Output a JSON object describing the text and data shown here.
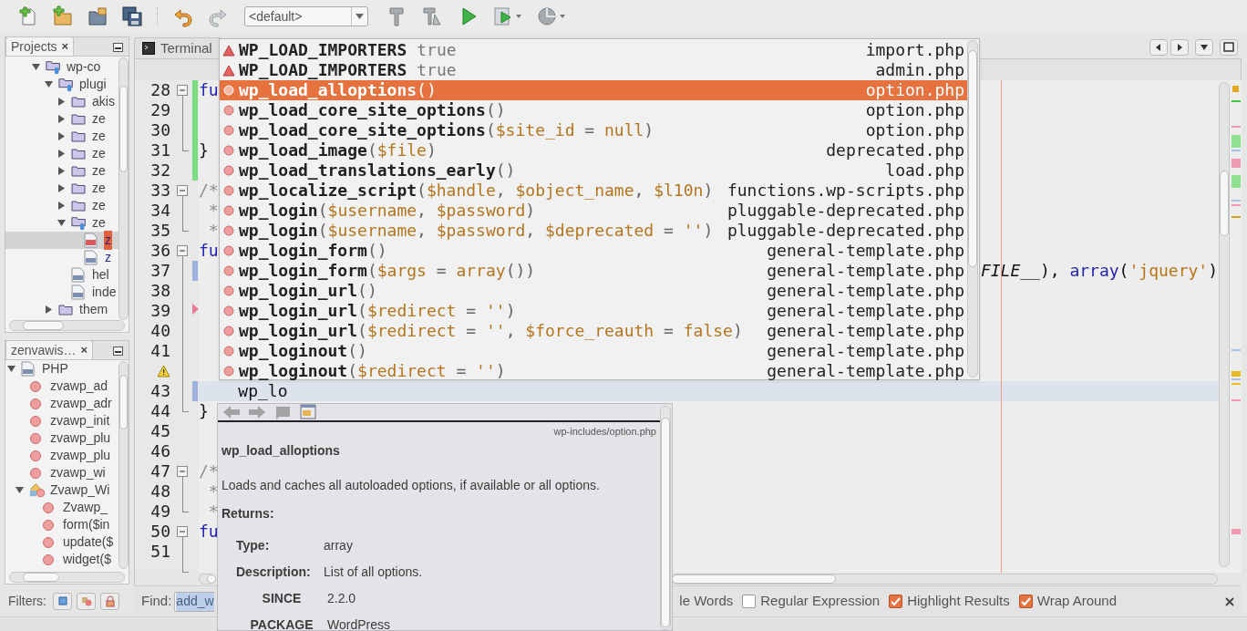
{
  "toolbar": {
    "config": "<default>"
  },
  "projects": {
    "title": "Projects",
    "close": "×",
    "tree": [
      {
        "label": "wp-co",
        "kind": "project",
        "expanded": true,
        "selected": false,
        "children": [
          {
            "label": "plugi",
            "kind": "project",
            "expanded": true,
            "selected": false,
            "children": [
              {
                "label": "akis",
                "kind": "folder",
                "expanded": false,
                "selected": false
              },
              {
                "label": "ze",
                "kind": "folder",
                "expanded": false,
                "selected": false
              },
              {
                "label": "ze",
                "kind": "folder",
                "expanded": false,
                "selected": false
              },
              {
                "label": "ze",
                "kind": "folder",
                "expanded": false,
                "selected": false
              },
              {
                "label": "ze",
                "kind": "folder",
                "expanded": false,
                "selected": false
              },
              {
                "label": "ze",
                "kind": "folder",
                "expanded": false,
                "selected": false
              },
              {
                "label": "ze",
                "kind": "folder",
                "expanded": false,
                "selected": false
              },
              {
                "label": "ze",
                "kind": "project",
                "expanded": true,
                "selected": false,
                "children": [
                  {
                    "label": "z",
                    "kind": "js",
                    "selected": true
                  },
                  {
                    "label": "z",
                    "kind": "php",
                    "selected": false
                  }
                ]
              },
              {
                "label": "hel",
                "kind": "php",
                "selected": false
              },
              {
                "label": "inde",
                "kind": "php",
                "selected": false
              }
            ]
          },
          {
            "label": "them",
            "kind": "folder",
            "expanded": false,
            "selected": false
          }
        ]
      }
    ]
  },
  "navigator": {
    "title": "zenvawis…",
    "close": "×",
    "tree": [
      {
        "label": "PHP",
        "kind": "php",
        "expanded": true,
        "selected": false,
        "children": [
          {
            "label": "zvawp_ad",
            "kind": "function",
            "selected": false
          },
          {
            "label": "zvawp_adr",
            "kind": "function",
            "selected": false
          },
          {
            "label": "zvawp_init",
            "kind": "function",
            "selected": false
          },
          {
            "label": "zvawp_plu",
            "kind": "function",
            "selected": false
          },
          {
            "label": "zvawp_plu",
            "kind": "function",
            "selected": false
          },
          {
            "label": "zvawp_wi",
            "kind": "function",
            "selected": false
          },
          {
            "label": "Zvawp_Wi",
            "kind": "class",
            "expanded": true,
            "selected": false,
            "children": [
              {
                "label": "Zvawp_",
                "kind": "function",
                "selected": false
              },
              {
                "label": "form($in",
                "kind": "function",
                "selected": false
              },
              {
                "label": "update($",
                "kind": "function",
                "selected": false
              },
              {
                "label": "widget($",
                "kind": "function",
                "selected": false
              }
            ]
          }
        ]
      }
    ]
  },
  "filters": {
    "label": "Filters:",
    "buttons": [
      {
        "kind": "fields"
      },
      {
        "kind": "static"
      },
      {
        "kind": "private"
      }
    ]
  },
  "editor": {
    "tabs": [
      {
        "label": "Terminal"
      }
    ],
    "lines": [
      {
        "number": "28",
        "current": false,
        "marks": [
          {
            "kind": "fold_start"
          },
          {
            "kind": "added"
          }
        ],
        "code": [
          {
            "text": "fu",
            "kind": "keyword"
          }
        ]
      },
      {
        "number": "29",
        "current": false,
        "marks": [
          {
            "kind": "fold_line"
          },
          {
            "kind": "added"
          }
        ]
      },
      {
        "number": "30",
        "current": false,
        "marks": [
          {
            "kind": "fold_line"
          },
          {
            "kind": "added"
          }
        ]
      },
      {
        "number": "31",
        "current": false,
        "marks": [
          {
            "kind": "fold_end"
          },
          {
            "kind": "added"
          }
        ],
        "code": [
          {
            "text": "}",
            "kind": "plain"
          }
        ]
      },
      {
        "number": "32",
        "current": false,
        "marks": [
          {
            "kind": "added"
          }
        ]
      },
      {
        "number": "33",
        "current": false,
        "marks": [
          {
            "kind": "fold_start"
          }
        ],
        "code": [
          {
            "text": "/*",
            "kind": "comment"
          }
        ]
      },
      {
        "number": "34",
        "current": false,
        "marks": [
          {
            "kind": "fold_line"
          }
        ],
        "code": [
          {
            "text": " *",
            "kind": "comment"
          }
        ]
      },
      {
        "number": "35",
        "current": false,
        "marks": [
          {
            "kind": "fold_end"
          }
        ],
        "code": [
          {
            "text": " *",
            "kind": "comment"
          }
        ]
      },
      {
        "number": "36",
        "current": false,
        "marks": [
          {
            "kind": "fold_start"
          }
        ],
        "code": [
          {
            "text": "fu",
            "kind": "keyword"
          }
        ]
      },
      {
        "number": "37",
        "current": false,
        "marks": [
          {
            "kind": "fold_line"
          },
          {
            "kind": "modified"
          }
        ],
        "tail": [
          {
            "text": "FILE__",
            "kind": "constant"
          },
          {
            "text": "), ",
            "kind": "plain"
          },
          {
            "text": "array",
            "kind": "keyword"
          },
          {
            "text": "(",
            "kind": "plain"
          },
          {
            "text": "'jquery'",
            "kind": "string"
          },
          {
            "text": ")",
            "kind": "plain"
          }
        ]
      },
      {
        "number": "38",
        "current": false,
        "marks": [
          {
            "kind": "fold_line"
          }
        ]
      },
      {
        "number": "39",
        "current": false,
        "marks": [
          {
            "kind": "fold_line"
          },
          {
            "kind": "deleted"
          }
        ]
      },
      {
        "number": "40",
        "current": false,
        "marks": [
          {
            "kind": "fold_line"
          }
        ]
      },
      {
        "number": "41",
        "current": false,
        "marks": [
          {
            "kind": "fold_line"
          }
        ]
      },
      {
        "current": false,
        "marks": [
          {
            "kind": "warning"
          },
          {
            "kind": "fold_line"
          }
        ]
      },
      {
        "number": "43",
        "current": true,
        "marks": [
          {
            "kind": "fold_line"
          },
          {
            "kind": "modified"
          }
        ],
        "code": [
          {
            "text": "    wp_lo",
            "kind": "plain"
          }
        ]
      },
      {
        "number": "44",
        "current": false,
        "marks": [
          {
            "kind": "fold_end"
          }
        ],
        "code": [
          {
            "text": "}",
            "kind": "plain"
          }
        ]
      },
      {
        "number": "45",
        "current": false
      },
      {
        "number": "46",
        "current": false
      },
      {
        "number": "47",
        "current": false,
        "marks": [
          {
            "kind": "fold_start"
          }
        ],
        "code": [
          {
            "text": "/*",
            "kind": "comment"
          }
        ]
      },
      {
        "number": "48",
        "current": false,
        "marks": [
          {
            "kind": "fold_line"
          }
        ],
        "code": [
          {
            "text": " *",
            "kind": "comment"
          }
        ]
      },
      {
        "number": "49",
        "current": false,
        "marks": [
          {
            "kind": "fold_end"
          }
        ],
        "code": [
          {
            "text": " *",
            "kind": "comment"
          }
        ]
      },
      {
        "number": "50",
        "current": false,
        "marks": [
          {
            "kind": "fold_start"
          }
        ],
        "code": [
          {
            "text": "fu",
            "kind": "keyword"
          }
        ]
      },
      {
        "number": "51",
        "current": false,
        "marks": [
          {
            "kind": "fold_line"
          }
        ]
      },
      {
        "current": false,
        "marks": [
          {
            "kind": "fold_end"
          }
        ]
      }
    ]
  },
  "completion": {
    "items": [
      {
        "kind": "constant",
        "name": "WP_LOAD_IMPORTERS",
        "value": "true",
        "file": "import.php",
        "selected": false
      },
      {
        "kind": "constant",
        "name": "WP_LOAD_IMPORTERS",
        "value": "true",
        "file": "admin.php",
        "selected": false
      },
      {
        "kind": "function",
        "name": "wp_load_alloptions",
        "params": "()",
        "file": "option.php",
        "selected": true
      },
      {
        "kind": "function",
        "name": "wp_load_core_site_options",
        "params": "()",
        "file": "option.php",
        "selected": false
      },
      {
        "kind": "function",
        "name": "wp_load_core_site_options",
        "params": "($site_id = null)",
        "file": "option.php",
        "selected": false
      },
      {
        "kind": "function",
        "name": "wp_load_image",
        "params": "($file)",
        "file": "deprecated.php",
        "selected": false
      },
      {
        "kind": "function",
        "name": "wp_load_translations_early",
        "params": "()",
        "file": "load.php",
        "selected": false
      },
      {
        "kind": "function",
        "name": "wp_localize_script",
        "params": "($handle, $object_name, $l10n)",
        "file": "functions.wp-scripts.php",
        "selected": false
      },
      {
        "kind": "function",
        "name": "wp_login",
        "params": "($username, $password)",
        "file": "pluggable-deprecated.php",
        "selected": false
      },
      {
        "kind": "function",
        "name": "wp_login",
        "params": "($username, $password, $deprecated = '')",
        "file": "pluggable-deprecated.php",
        "selected": false
      },
      {
        "kind": "function",
        "name": "wp_login_form",
        "params": "()",
        "file": "general-template.php",
        "selected": false
      },
      {
        "kind": "function",
        "name": "wp_login_form",
        "params": "($args = array())",
        "file": "general-template.php",
        "selected": false
      },
      {
        "kind": "function",
        "name": "wp_login_url",
        "params": "()",
        "file": "general-template.php",
        "selected": false
      },
      {
        "kind": "function",
        "name": "wp_login_url",
        "params": "($redirect = '')",
        "file": "general-template.php",
        "selected": false
      },
      {
        "kind": "function",
        "name": "wp_login_url",
        "params": "($redirect = '', $force_reauth = false)",
        "file": "general-template.php",
        "selected": false
      },
      {
        "kind": "function",
        "name": "wp_loginout",
        "params": "()",
        "file": "general-template.php",
        "selected": false
      },
      {
        "kind": "function",
        "name": "wp_loginout",
        "params": "($redirect = '')",
        "file": "general-template.php",
        "selected": false
      }
    ]
  },
  "doc": {
    "path": "wp-includes/option.php",
    "title": "wp_load_alloptions",
    "description": "Loads and caches all autoloaded options, if available or all options.",
    "returns_label": "Returns:",
    "returns": [
      {
        "label": "Type:",
        "value": "array"
      },
      {
        "label": "Description:",
        "value": "List of all options."
      }
    ],
    "tags": [
      {
        "label": "SINCE",
        "value": "2.2.0"
      },
      {
        "label": "PACKAGE",
        "value": "WordPress"
      }
    ]
  },
  "find": {
    "label": "Find:",
    "value": "add_w",
    "partial_option": "le Words",
    "options": [
      {
        "label": "Regular Expression",
        "checked": false
      },
      {
        "label": "Highlight Results",
        "checked": true
      },
      {
        "label": "Wrap Around",
        "checked": true
      }
    ]
  }
}
